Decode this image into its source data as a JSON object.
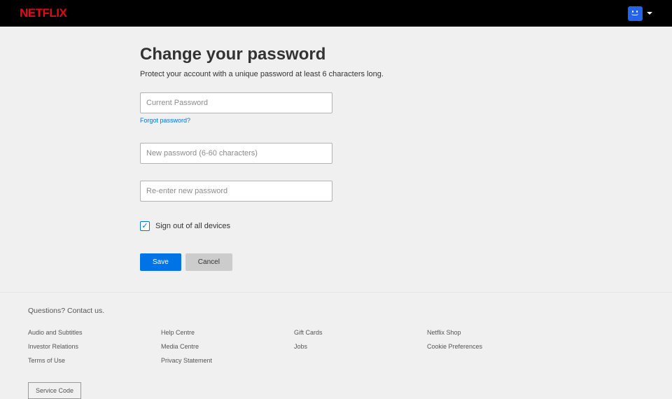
{
  "header": {
    "logo": "NETFLIX"
  },
  "page": {
    "title": "Change your password",
    "subtitle": "Protect your account with a unique password at least 6 characters long."
  },
  "form": {
    "current_password_placeholder": "Current Password",
    "forgot_password": "Forgot password?",
    "new_password_placeholder": "New password (6-60 characters)",
    "confirm_password_placeholder": "Re-enter new password",
    "signout_label": "Sign out of all devices",
    "save_label": "Save",
    "cancel_label": "Cancel"
  },
  "footer": {
    "questions": "Questions? Contact us.",
    "col1": {
      "l1": "Audio and Subtitles",
      "l2": "Investor Relations",
      "l3": "Terms of Use"
    },
    "col2": {
      "l1": "Help Centre",
      "l2": "Media Centre",
      "l3": "Privacy Statement"
    },
    "col3": {
      "l1": "Gift Cards",
      "l2": "Jobs"
    },
    "col4": {
      "l1": "Netflix Shop",
      "l2": "Cookie Preferences"
    },
    "service_code": "Service Code"
  }
}
